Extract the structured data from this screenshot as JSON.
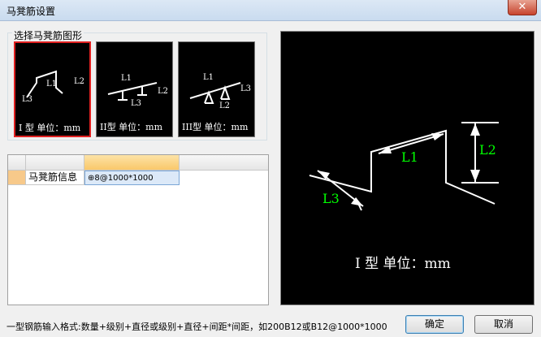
{
  "window": {
    "title": "马凳筋设置",
    "close_glyph": "✕"
  },
  "shape_group": {
    "label": "选择马凳筋图形",
    "shapes": [
      {
        "caption": "I 型  单位：mm",
        "selected": true,
        "labels": [
          "L1",
          "L2",
          "L3"
        ]
      },
      {
        "caption": "II型  单位：mm",
        "selected": false,
        "labels": [
          "L1",
          "L2",
          "L3"
        ]
      },
      {
        "caption": "III型  单位：mm",
        "selected": false,
        "labels": [
          "L1",
          "L2",
          "L3"
        ]
      }
    ]
  },
  "grid": {
    "rows": [
      {
        "name": "马凳筋信息",
        "value": "⊕8@1000*1000"
      }
    ]
  },
  "preview": {
    "labels": [
      "L1",
      "L2",
      "L3"
    ],
    "caption": "I 型  单位：mm",
    "label_color": "#00ff00"
  },
  "footer": {
    "hint": "一型钢筋输入格式:数量+级别+直径或级别+直径+间距*间距，如200B12或B12@1000*1000",
    "ok_label": "确定",
    "cancel_label": "取消"
  },
  "colors": {
    "selected_border": "#e02020",
    "header_accent": "#f9c86a",
    "row_accent": "#f7c98a",
    "value_cell": "#dce9f8"
  }
}
